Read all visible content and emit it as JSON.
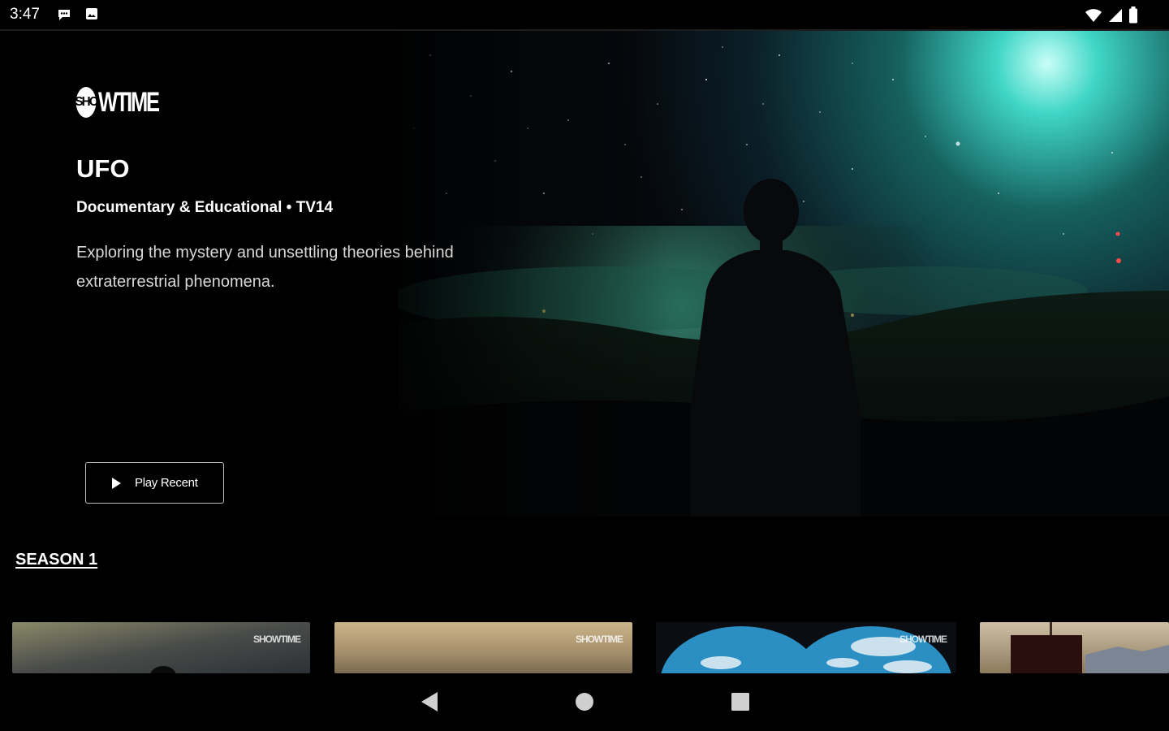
{
  "status_bar": {
    "time": "3:47",
    "left_icons": [
      "chat-icon",
      "photo-icon"
    ],
    "right_icons": [
      "wifi-icon",
      "signal-icon",
      "battery-icon"
    ]
  },
  "hero": {
    "brand": "SHOWTIME",
    "brand_circle": "SHO",
    "brand_rest": "WTIME",
    "title": "UFO",
    "meta": "Documentary & Educational • TV14",
    "description": "Exploring the mystery and unsettling theories behind extraterrestrial phenomena.",
    "play_label": "Play Recent"
  },
  "season": {
    "label": "SEASON 1"
  },
  "episodes": [
    {
      "logo": "SHOWTIME",
      "style": "dusk-sky"
    },
    {
      "logo": "SHOWTIME",
      "style": "desert-haze"
    },
    {
      "logo": "SHOWTIME",
      "style": "binocular-sky"
    },
    {
      "logo": "",
      "style": "landscape"
    }
  ],
  "nav_bar": {
    "buttons": [
      "back-icon",
      "home-icon",
      "recents-icon"
    ]
  },
  "colors": {
    "background": "#000000",
    "text": "#ffffff",
    "muted_text": "#d8d8d8",
    "button_border": "#bdbdbd"
  }
}
